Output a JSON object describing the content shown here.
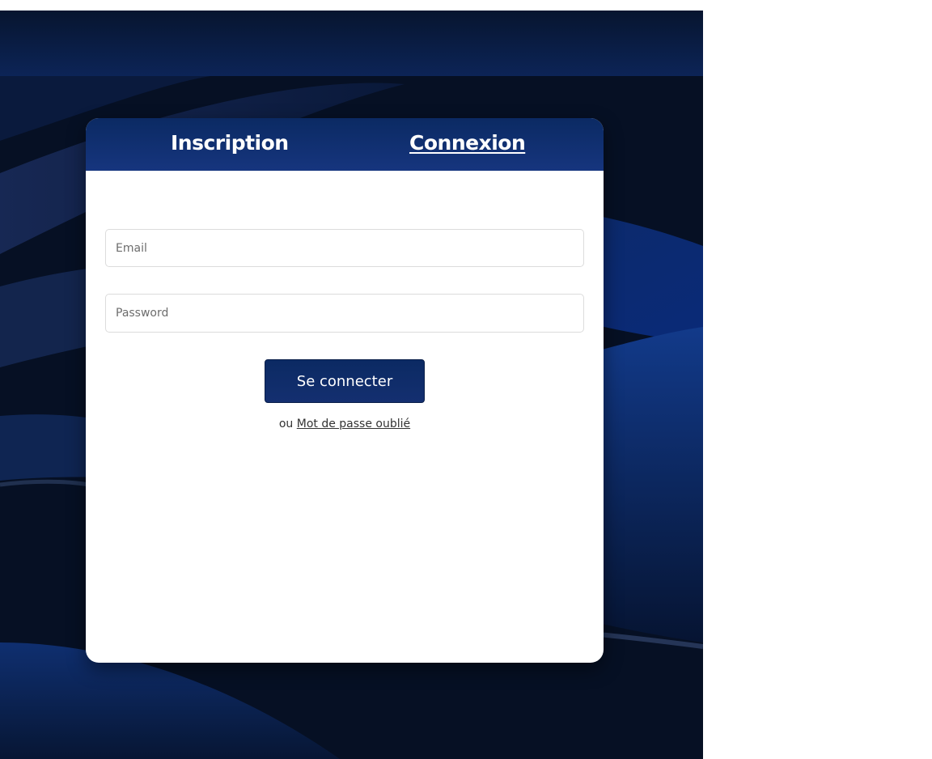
{
  "tabs": {
    "inscription": "Inscription",
    "connexion": "Connexion",
    "active": "Connexion"
  },
  "form": {
    "email_placeholder": "Email",
    "email_value": "",
    "password_placeholder": "Password",
    "password_value": "",
    "submit_label": "Se connecter",
    "or_text": "ou",
    "forgot_link": "Mot de passe oublié"
  },
  "colors": {
    "header_dark": "#07152f",
    "accent_blue": "#0b2a63",
    "background_navy": "#061024",
    "card_background": "#ffffff"
  }
}
